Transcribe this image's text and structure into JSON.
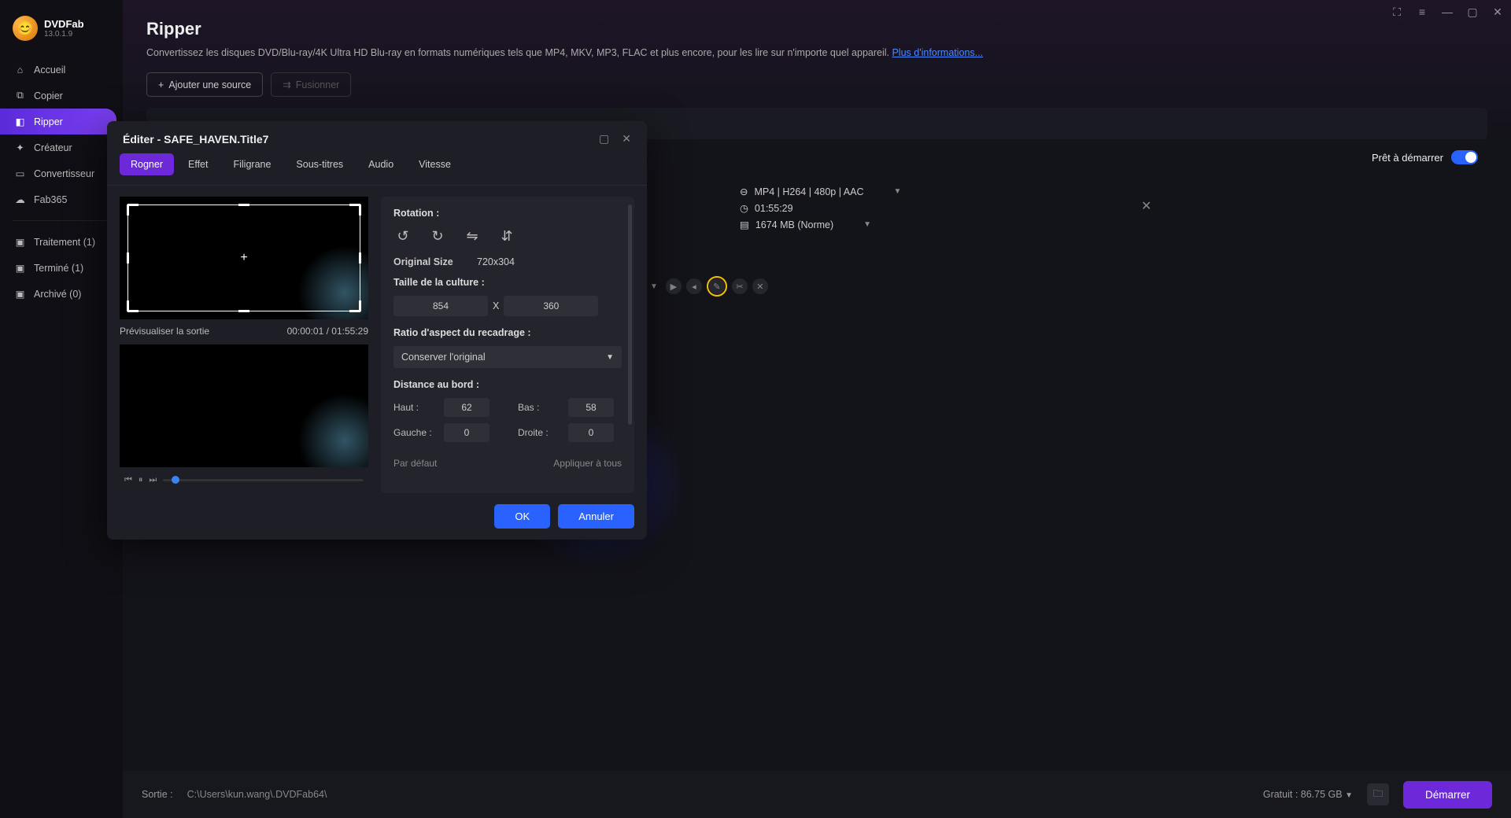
{
  "app": {
    "name": "DVDFab",
    "version": "13.0.1.9"
  },
  "sidebar": {
    "items": [
      {
        "label": "Accueil"
      },
      {
        "label": "Copier"
      },
      {
        "label": "Ripper"
      },
      {
        "label": "Créateur"
      },
      {
        "label": "Convertisseur"
      },
      {
        "label": "Fab365"
      }
    ],
    "status": [
      {
        "label": "Traitement (1)"
      },
      {
        "label": "Terminé (1)"
      },
      {
        "label": "Archivé (0)"
      }
    ]
  },
  "page": {
    "title": "Ripper",
    "description": "Convertissez les disques DVD/Blu-ray/4K Ultra HD Blu-ray en formats numériques tels que MP4, MKV, MP3, FLAC et plus encore, pour les lire sur n'importe quel appareil. ",
    "more_link": "Plus d'informations...",
    "add_source": "Ajouter une source",
    "merge": "Fusionner",
    "ready": "Prêt à démarrer"
  },
  "item": {
    "format": "MP4 | H264 | 480p | AAC",
    "duration": "01:55:29",
    "size": "1674 MB (Norme)"
  },
  "modal": {
    "title": "Éditer - SAFE_HAVEN.Title7",
    "tabs": [
      "Rogner",
      "Effet",
      "Filigrane",
      "Sous-titres",
      "Audio",
      "Vitesse"
    ],
    "preview_label": "Prévisualiser la sortie",
    "timecode": "00:00:01 / 01:55:29",
    "rotation_label": "Rotation :",
    "original_size_label": "Original Size",
    "original_size_value": "720x304",
    "crop_size_label": "Taille de la culture :",
    "crop_w": "854",
    "crop_h": "360",
    "x_sep": "X",
    "aspect_label": "Ratio d'aspect du recadrage :",
    "aspect_value": "Conserver l'original",
    "edge_label": "Distance au bord :",
    "edge_top_l": "Haut :",
    "edge_top": "62",
    "edge_bottom_l": "Bas :",
    "edge_bottom": "58",
    "edge_left_l": "Gauche :",
    "edge_left": "0",
    "edge_right_l": "Droite :",
    "edge_right": "0",
    "default": "Par défaut",
    "apply_all": "Appliquer à tous",
    "ok": "OK",
    "cancel": "Annuler"
  },
  "bottom": {
    "output_label": "Sortie :",
    "output_path": "C:\\Users\\kun.wang\\.DVDFab64\\",
    "free_space": "Gratuit : 86.75 GB",
    "start": "Démarrer"
  }
}
